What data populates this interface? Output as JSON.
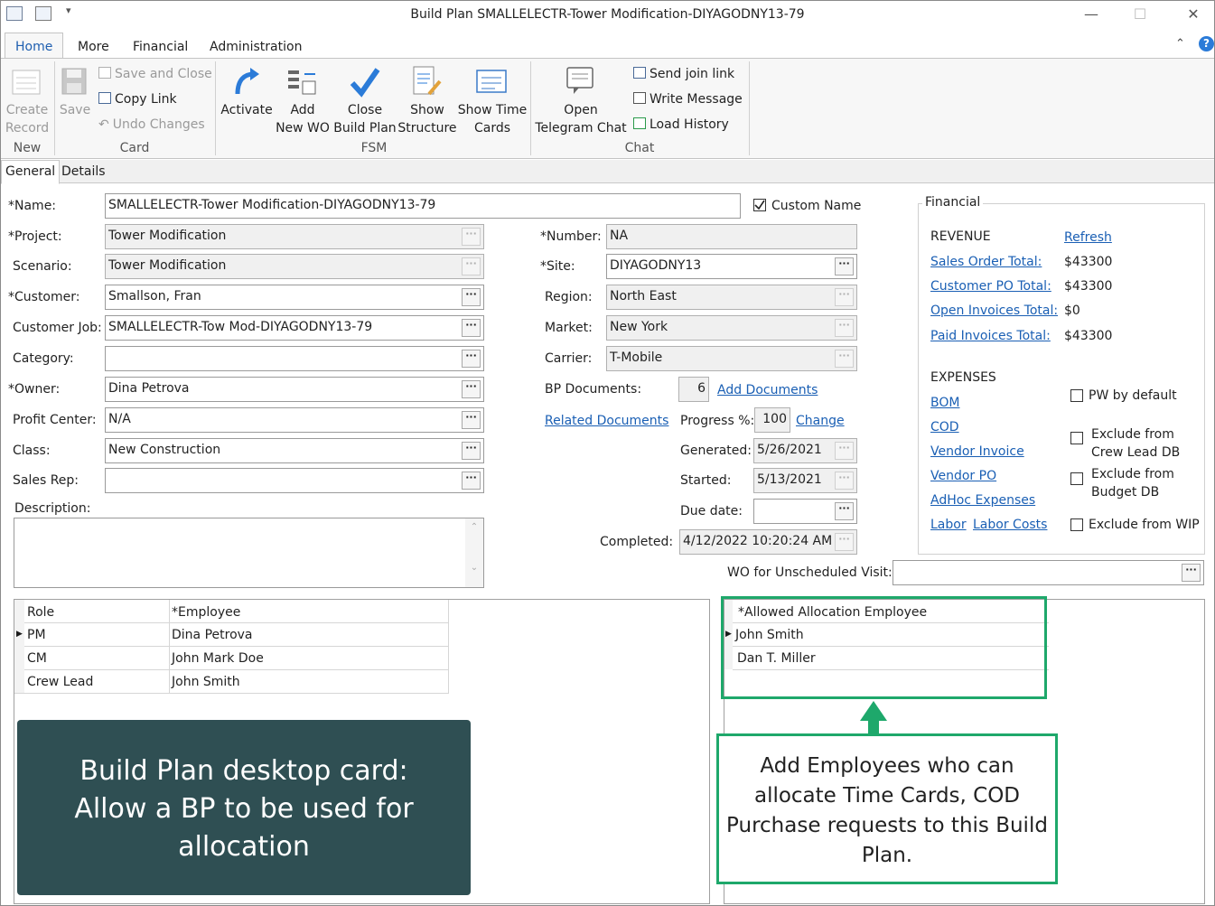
{
  "window": {
    "title": "Build Plan SMALLELECTR-Tower Modification-DIYAGODNY13-79"
  },
  "ribbon_tabs": [
    "Home",
    "More",
    "Financial",
    "Administration"
  ],
  "ribbon": {
    "new": {
      "create_record": "Create\nRecord",
      "group": "New"
    },
    "card": {
      "save": "Save",
      "save_and_close": "Save and Close",
      "copy_link": "Copy Link",
      "undo_changes": "Undo Changes",
      "group": "Card"
    },
    "fsm": {
      "activate": "Activate",
      "add_new_wo": "Add\nNew WO",
      "close_build_plan": "Close\nBuild Plan",
      "show_structure": "Show\nStructure",
      "show_time_cards": "Show Time\nCards",
      "group": "FSM"
    },
    "chat": {
      "open_telegram_chat": "Open\nTelegram Chat",
      "send_join_link": "Send join link",
      "write_message": "Write Message",
      "load_history": "Load History",
      "group": "Chat"
    }
  },
  "card_tabs": [
    "General",
    "Details"
  ],
  "form": {
    "name": {
      "label": "*Name:",
      "value": "SMALLELECTR-Tower Modification-DIYAGODNY13-79"
    },
    "custom_name": {
      "label": "Custom Name",
      "checked": true
    },
    "project": {
      "label": "*Project:",
      "value": "Tower Modification"
    },
    "scenario": {
      "label": "Scenario:",
      "value": "Tower Modification"
    },
    "customer": {
      "label": "*Customer:",
      "value": "Smallson, Fran"
    },
    "customer_job": {
      "label": "Customer Job:",
      "value": "SMALLELECTR-Tow Mod-DIYAGODNY13-79"
    },
    "category": {
      "label": "Category:",
      "value": ""
    },
    "owner": {
      "label": "*Owner:",
      "value": "Dina Petrova"
    },
    "profit_center": {
      "label": "Profit Center:",
      "value": "N/A"
    },
    "class": {
      "label": "Class:",
      "value": "New Construction"
    },
    "sales_rep": {
      "label": "Sales Rep:",
      "value": ""
    },
    "description": {
      "label": "Description:",
      "value": ""
    },
    "number": {
      "label": "*Number:",
      "value": "NA"
    },
    "site": {
      "label": "*Site:",
      "value": "DIYAGODNY13"
    },
    "region": {
      "label": "Region:",
      "value": "North East"
    },
    "market": {
      "label": "Market:",
      "value": "New York"
    },
    "carrier": {
      "label": "Carrier:",
      "value": "T-Mobile"
    },
    "bp_documents": {
      "label": "BP Documents:",
      "value": "6",
      "link": "Add Documents"
    },
    "related_documents": "Related Documents",
    "progress": {
      "label": "Progress %:",
      "value": "100",
      "link": "Change"
    },
    "generated": {
      "label": "Generated:",
      "value": "5/26/2021"
    },
    "started": {
      "label": "Started:",
      "value": "5/13/2021"
    },
    "due_date": {
      "label": "Due date:",
      "value": ""
    },
    "completed": {
      "label": "Completed:",
      "value": "4/12/2022 10:20:24 AM"
    },
    "wo_unscheduled": {
      "label": "WO for Unscheduled Visit:",
      "value": ""
    }
  },
  "financial": {
    "title": "Financial",
    "revenue": "REVENUE",
    "refresh": "Refresh",
    "rows": [
      {
        "label": "Sales Order Total:",
        "value": "$43300"
      },
      {
        "label": "Customer PO Total:",
        "value": "$43300"
      },
      {
        "label": "Open Invoices Total:",
        "value": "$0"
      },
      {
        "label": "Paid Invoices Total:",
        "value": "$43300"
      }
    ],
    "expenses": "EXPENSES",
    "expense_links": [
      "BOM",
      "COD",
      "Vendor Invoice",
      "Vendor PO",
      "AdHoc Expenses",
      "Labor",
      "Labor Costs"
    ],
    "checkboxes": [
      "PW by default",
      "Exclude from\nCrew Lead DB",
      "Exclude from\nBudget DB",
      "Exclude from WIP"
    ]
  },
  "roles_grid": {
    "headers": [
      "Role",
      "*Employee"
    ],
    "rows": [
      [
        "PM",
        "Dina Petrova"
      ],
      [
        "CM",
        "John Mark Doe"
      ],
      [
        "Crew Lead",
        "John Smith"
      ]
    ]
  },
  "allocation_grid": {
    "header": "*Allowed Allocation Employee",
    "rows": [
      "John Smith",
      "Dan T. Miller"
    ]
  },
  "callouts": {
    "dark": "Build Plan desktop card:\nAllow a BP to be used for\nallocation",
    "green": "Add Employees who can\nallocate Time Cards, COD\nPurchase requests to this Build\nPlan.",
    "accent_green": "#1ea86b",
    "dark_bg": "#2f4f53"
  }
}
